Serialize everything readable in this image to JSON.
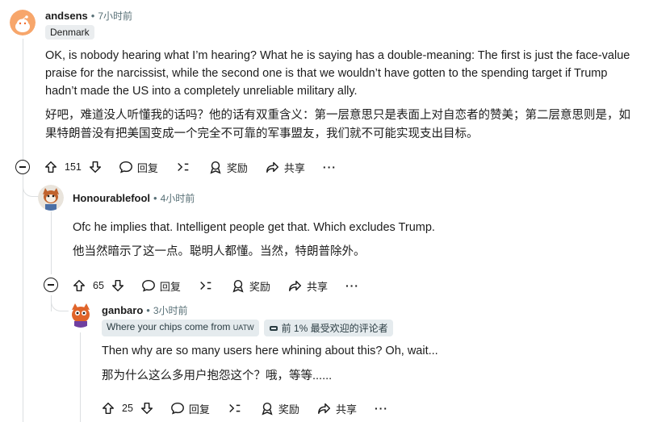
{
  "comments": [
    {
      "author": "andsens",
      "time": "7小时前",
      "flair": "Denmark",
      "text_en": "OK, is nobody hearing what I’m hearing? What he is saying has a double-meaning: The first is just the face-value praise for the narcissist, while the second one is that we wouldn’t have gotten to the spending target if Trump hadn’t made the US into a completely unreliable military ally.",
      "text_zh": "好吧，难道没人听懂我的话吗？他的话有双重含义：第一层意思只是表面上对自恋者的赞美；第二层意思则是，如果特朗普没有把美国变成一个完全不可靠的军事盟友，我们就不可能实现支出目标。",
      "votes": "151",
      "reply": "回复",
      "award": "奖励",
      "share": "共享",
      "more": "···"
    },
    {
      "author": "Honourablefool",
      "time": "4小时前",
      "text_en": "Ofc he implies that. Intelligent people get that. Which excludes Trump.",
      "text_zh": "他当然暗示了这一点。聪明人都懂。当然，特朗普除外。",
      "votes": "65",
      "reply": "回复",
      "award": "奖励",
      "share": "共享",
      "more": "···"
    },
    {
      "author": "ganbaro",
      "time": "3小时前",
      "flair_main": "Where your chips come from",
      "flair_tag": "UATW",
      "flair_badge": "前 1% 最受欢迎的评论者",
      "text_en": "Then why are so many users here whining about this? Oh, wait...",
      "text_zh": "那为什么这么多用户抱怨这个？哦，等等......",
      "votes": "25",
      "reply": "回复",
      "award": "奖励",
      "share": "共享",
      "more": "···"
    }
  ],
  "colors": {
    "accent": "#2a3c42",
    "meta": "#576f76",
    "line": "#dcdfe1"
  },
  "icons": [
    "upvote-icon",
    "downvote-icon",
    "reply-icon",
    "share-link-icon",
    "award-icon",
    "share-icon",
    "collapse-icon",
    "avatar"
  ]
}
